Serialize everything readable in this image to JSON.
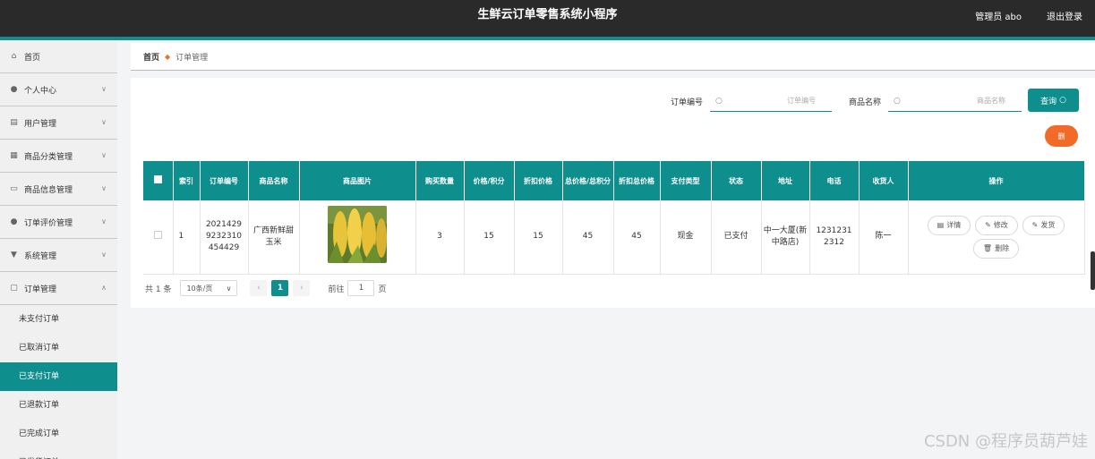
{
  "header": {
    "title": "生鲜云订单零售系统小程序",
    "admin": "管理员 abo",
    "logout": "退出登录"
  },
  "sidebar": {
    "items": [
      {
        "label": "首页",
        "icon": "home-icon",
        "glyph": "⌂",
        "chevron": false
      },
      {
        "label": "个人中心",
        "icon": "user-icon",
        "glyph": "●",
        "chevron": true
      },
      {
        "label": "用户管理",
        "icon": "clipboard-icon",
        "glyph": "▤",
        "chevron": true
      },
      {
        "label": "商品分类管理",
        "icon": "grid-icon",
        "glyph": "▦",
        "chevron": true
      },
      {
        "label": "商品信息管理",
        "icon": "store-icon",
        "glyph": "▭",
        "chevron": true
      },
      {
        "label": "订单评价管理",
        "icon": "user-icon",
        "glyph": "●",
        "chevron": true
      },
      {
        "label": "系统管理",
        "icon": "settings-icon",
        "glyph": "▼",
        "chevron": true
      },
      {
        "label": "订单管理",
        "icon": "chat-icon",
        "glyph": "▢",
        "chevron": true,
        "expanded": true
      }
    ],
    "subitems": [
      "未支付订单",
      "已取消订单",
      "已支付订单",
      "已退款订单",
      "已完成订单",
      "已发货订单"
    ],
    "active_sub": 2
  },
  "breadcrumb": {
    "home": "首页",
    "current": "订单管理"
  },
  "search": {
    "order_no_label": "订单编号",
    "order_no_placeholder": "订单编号",
    "product_label": "商品名称",
    "product_placeholder": "商品名称",
    "query_label": "查询",
    "delete_label": "删"
  },
  "table": {
    "headers": [
      "索引",
      "订单编号",
      "商品名称",
      "商品图片",
      "购买数量",
      "价格/积分",
      "折扣价格",
      "总价格/总积分",
      "折扣总价格",
      "支付类型",
      "状态",
      "地址",
      "电话",
      "收货人",
      "操作"
    ],
    "rows": [
      {
        "index": "1",
        "order_no": "2021429 9232310 454429",
        "product": "广西新鲜甜玉米",
        "qty": "3",
        "price": "15",
        "discount_price": "15",
        "total": "45",
        "discount_total": "45",
        "pay_type": "现金",
        "status": "已支付",
        "address": "中一大厦(新中路店)",
        "phone": "1231231 2312",
        "receiver": "陈一"
      }
    ],
    "actions": {
      "detail": "详情",
      "edit": "修改",
      "ship": "发货",
      "delete": "删除"
    }
  },
  "pager": {
    "total": "共 1 条",
    "page_size": "10条/页",
    "current": "1",
    "goto_label": "前往",
    "goto_value": "1",
    "page_unit": "页"
  },
  "watermark": "CSDN @程序员葫芦娃"
}
